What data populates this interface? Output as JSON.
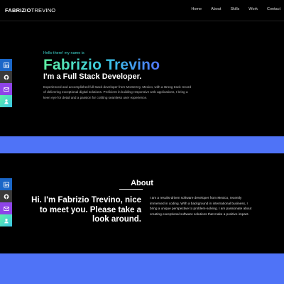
{
  "brand": {
    "first": "FABRIZIO",
    "last": "TREVINO"
  },
  "nav": {
    "items": [
      "Home",
      "About",
      "Skills",
      "Work",
      "Contact"
    ]
  },
  "hero": {
    "greeting": "Hello there! my name is",
    "name": "Fabrizio Trevino",
    "role": "I'm a Full Stack Developer.",
    "description": "Experienced and accomplished full-stack developer from Monterrey, Mexico, with a strong track record of delivering exceptional digital solutions. Proficient in building responsive web applications, I bring a keen eye for detail and a passion for crafting seamless user experience."
  },
  "about": {
    "title": "About",
    "headline": "Hi. I'm Fabrizio Trevino, nice to meet you. Please take a look around.",
    "text": "I am a results-driven software developer from Mexico, recently immersed in coding. With a background in international business, I bring a unique perspective to problem-solving. I am passionate about creating exceptional software solutions that make a positive impact."
  },
  "social": {
    "icons": [
      "linkedin-icon",
      "github-icon",
      "mail-icon",
      "user-icon"
    ]
  },
  "colors": {
    "accent_blue": "#4f73f7",
    "greeting_teal": "#3fd8d0",
    "linkedin": "#1a66c7",
    "github": "#3a3a3a",
    "mail": "#8e44e8"
  }
}
